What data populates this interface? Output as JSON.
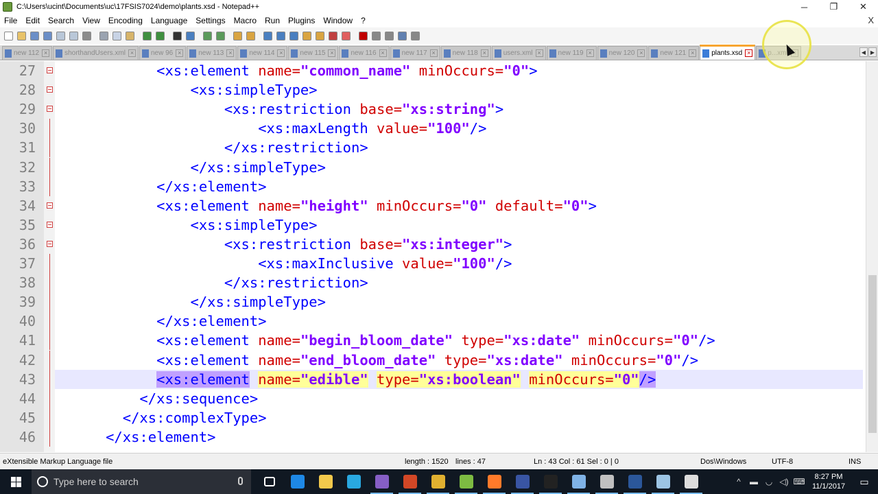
{
  "window": {
    "title": "C:\\Users\\ucint\\Documents\\uc\\17FSIS7024\\demo\\plants.xsd - Notepad++",
    "buttons": [
      "─",
      "❐",
      "✕"
    ]
  },
  "menu": {
    "items": [
      "File",
      "Edit",
      "Search",
      "View",
      "Encoding",
      "Language",
      "Settings",
      "Macro",
      "Run",
      "Plugins",
      "Window",
      "?"
    ],
    "close_doc": "X"
  },
  "toolbar": {
    "buttons": [
      {
        "name": "new-file-icon",
        "color": "#ffffff"
      },
      {
        "name": "open-file-icon",
        "color": "#e8c36a"
      },
      {
        "name": "save-icon",
        "color": "#6b8ec7"
      },
      {
        "name": "save-all-icon",
        "color": "#6b8ec7"
      },
      {
        "name": "close-icon",
        "color": "#b9c7d8"
      },
      {
        "name": "close-all-icon",
        "color": "#b9c7d8"
      },
      {
        "name": "print-icon",
        "color": "#8c8c8c"
      },
      {
        "name": "cut-icon",
        "color": "#9aa3b0"
      },
      {
        "name": "copy-icon",
        "color": "#c8d3e5"
      },
      {
        "name": "paste-icon",
        "color": "#d7b46a"
      },
      {
        "name": "undo-icon",
        "color": "#3f8f3f"
      },
      {
        "name": "redo-icon",
        "color": "#3f8f3f"
      },
      {
        "name": "find-icon",
        "color": "#333333"
      },
      {
        "name": "replace-icon",
        "color": "#4a7fc0"
      },
      {
        "name": "zoom-in-icon",
        "color": "#5a9a5a"
      },
      {
        "name": "zoom-out-icon",
        "color": "#5a9a5a"
      },
      {
        "name": "sync-vertical-icon",
        "color": "#d9a441"
      },
      {
        "name": "sync-horizontal-icon",
        "color": "#d9a441"
      },
      {
        "name": "word-wrap-icon",
        "color": "#4a7fc0"
      },
      {
        "name": "show-all-chars-icon",
        "color": "#4a7fc0"
      },
      {
        "name": "indent-guide-icon",
        "color": "#4a7fc0"
      },
      {
        "name": "udl-icon",
        "color": "#d9a441"
      },
      {
        "name": "doc-map-icon",
        "color": "#d9a441"
      },
      {
        "name": "function-list-icon",
        "color": "#c04040"
      },
      {
        "name": "folder-workspace-icon",
        "color": "#e06060"
      },
      {
        "name": "record-macro-icon",
        "color": "#c00000"
      },
      {
        "name": "stop-macro-icon",
        "color": "#888888"
      },
      {
        "name": "play-macro-icon",
        "color": "#888888"
      },
      {
        "name": "run-macro-multiple-icon",
        "color": "#6080b0"
      },
      {
        "name": "save-macro-icon",
        "color": "#888888"
      }
    ]
  },
  "tabs": [
    {
      "label": "new 112",
      "active": false
    },
    {
      "label": "shorthandUsers.xml",
      "active": false
    },
    {
      "label": "new 96",
      "active": false
    },
    {
      "label": "new 113",
      "active": false
    },
    {
      "label": "new 114",
      "active": false
    },
    {
      "label": "new 115",
      "active": false
    },
    {
      "label": "new 116",
      "active": false
    },
    {
      "label": "new 117",
      "active": false
    },
    {
      "label": "new 118",
      "active": false
    },
    {
      "label": "users.xml",
      "active": false
    },
    {
      "label": "new 119",
      "active": false
    },
    {
      "label": "new 120",
      "active": false
    },
    {
      "label": "new 121",
      "active": false
    },
    {
      "label": "plants.xsd",
      "active": true
    },
    {
      "label": "p...xml",
      "active": false
    }
  ],
  "tab_arrows": [
    "◀",
    "▶"
  ],
  "editor": {
    "current_line": 43,
    "lines": [
      {
        "num": "27",
        "indent": "            ",
        "fold": "box",
        "tokens": [
          [
            "tag",
            "<xs:element "
          ],
          [
            "attr",
            "name="
          ],
          [
            "val",
            "\"common_name\""
          ],
          [
            "attr",
            " minOccurs="
          ],
          [
            "val",
            "\"0\""
          ],
          [
            "tag",
            ">"
          ]
        ]
      },
      {
        "num": "28",
        "indent": "                ",
        "fold": "box",
        "tokens": [
          [
            "tag",
            "<xs:simpleType>"
          ]
        ]
      },
      {
        "num": "29",
        "indent": "                    ",
        "fold": "box",
        "tokens": [
          [
            "tag",
            "<xs:restriction "
          ],
          [
            "attr",
            "base="
          ],
          [
            "val",
            "\"xs:string\""
          ],
          [
            "tag",
            ">"
          ]
        ]
      },
      {
        "num": "30",
        "indent": "                        ",
        "fold": "line",
        "tokens": [
          [
            "tag",
            "<xs:maxLength "
          ],
          [
            "attr",
            "value="
          ],
          [
            "val",
            "\"100\""
          ],
          [
            "tag",
            "/>"
          ]
        ]
      },
      {
        "num": "31",
        "indent": "                    ",
        "fold": "line",
        "tokens": [
          [
            "tag",
            "</xs:restriction>"
          ]
        ]
      },
      {
        "num": "32",
        "indent": "                ",
        "fold": "line",
        "tokens": [
          [
            "tag",
            "</xs:simpleType>"
          ]
        ]
      },
      {
        "num": "33",
        "indent": "            ",
        "fold": "line",
        "tokens": [
          [
            "tag",
            "</xs:element>"
          ]
        ]
      },
      {
        "num": "34",
        "indent": "            ",
        "fold": "box",
        "tokens": [
          [
            "tag",
            "<xs:element "
          ],
          [
            "attr",
            "name="
          ],
          [
            "val",
            "\"height\""
          ],
          [
            "attr",
            " minOccurs="
          ],
          [
            "val",
            "\"0\""
          ],
          [
            "attr",
            " default="
          ],
          [
            "val",
            "\"0\""
          ],
          [
            "tag",
            ">"
          ]
        ]
      },
      {
        "num": "35",
        "indent": "                ",
        "fold": "box",
        "tokens": [
          [
            "tag",
            "<xs:simpleType>"
          ]
        ]
      },
      {
        "num": "36",
        "indent": "                    ",
        "fold": "box",
        "tokens": [
          [
            "tag",
            "<xs:restriction "
          ],
          [
            "attr",
            "base="
          ],
          [
            "val",
            "\"xs:integer\""
          ],
          [
            "tag",
            ">"
          ]
        ]
      },
      {
        "num": "37",
        "indent": "                        ",
        "fold": "line",
        "tokens": [
          [
            "tag",
            "<xs:maxInclusive "
          ],
          [
            "attr",
            "value="
          ],
          [
            "val",
            "\"100\""
          ],
          [
            "tag",
            "/>"
          ]
        ]
      },
      {
        "num": "38",
        "indent": "                    ",
        "fold": "line",
        "tokens": [
          [
            "tag",
            "</xs:restriction>"
          ]
        ]
      },
      {
        "num": "39",
        "indent": "                ",
        "fold": "line",
        "tokens": [
          [
            "tag",
            "</xs:simpleType>"
          ]
        ]
      },
      {
        "num": "40",
        "indent": "            ",
        "fold": "line",
        "tokens": [
          [
            "tag",
            "</xs:element>"
          ]
        ]
      },
      {
        "num": "41",
        "indent": "            ",
        "fold": "line",
        "tokens": [
          [
            "tag",
            "<xs:element "
          ],
          [
            "attr",
            "name="
          ],
          [
            "val",
            "\"begin_bloom_date\""
          ],
          [
            "attr",
            " type="
          ],
          [
            "val",
            "\"xs:date\""
          ],
          [
            "attr",
            " minOccurs="
          ],
          [
            "val",
            "\"0\""
          ],
          [
            "tag",
            "/>"
          ]
        ]
      },
      {
        "num": "42",
        "indent": "            ",
        "fold": "line",
        "tokens": [
          [
            "tag",
            "<xs:element "
          ],
          [
            "attr",
            "name="
          ],
          [
            "val",
            "\"end_bloom_date\""
          ],
          [
            "attr",
            " type="
          ],
          [
            "val",
            "\"xs:date\""
          ],
          [
            "attr",
            " minOccurs="
          ],
          [
            "val",
            "\"0\""
          ],
          [
            "tag",
            "/>"
          ]
        ]
      },
      {
        "num": "43",
        "indent": "            ",
        "fold": "line",
        "tokens": [
          [
            "sel-tag",
            "<xs:element"
          ],
          [
            "plain",
            " "
          ],
          [
            "sel-attr",
            "name="
          ],
          [
            "sel-val",
            "\"edible\""
          ],
          [
            "plain",
            " "
          ],
          [
            "sel-attr",
            "type="
          ],
          [
            "sel-val",
            "\"xs:boolean\""
          ],
          [
            "plain",
            " "
          ],
          [
            "sel-attr",
            "minOccurs="
          ],
          [
            "sel-val",
            "\"0\""
          ],
          [
            "sel-tag",
            "/>"
          ]
        ]
      },
      {
        "num": "44",
        "indent": "          ",
        "fold": "line",
        "tokens": [
          [
            "tag",
            "</xs:sequence>"
          ]
        ]
      },
      {
        "num": "45",
        "indent": "        ",
        "fold": "line",
        "tokens": [
          [
            "tag",
            "</xs:complexType>"
          ]
        ]
      },
      {
        "num": "46",
        "indent": "      ",
        "fold": "line",
        "tokens": [
          [
            "tag",
            "</xs:element>"
          ]
        ]
      }
    ]
  },
  "status": {
    "file_type": "eXtensible Markup Language file",
    "length": "length : 1520",
    "lines": "lines : 47",
    "position": "Ln : 43    Col : 61    Sel : 0 | 0",
    "eol": "Dos\\Windows",
    "encoding": "UTF-8",
    "mode": "INS"
  },
  "taskbar": {
    "search_placeholder": "Type here to search",
    "apps": [
      {
        "name": "task-view-icon",
        "color": "#ffffff",
        "running": false
      },
      {
        "name": "edge-icon",
        "color": "#1e88e5",
        "running": false
      },
      {
        "name": "file-explorer-icon",
        "color": "#f2c94c",
        "running": false
      },
      {
        "name": "skype-icon",
        "color": "#29a8e0",
        "running": false
      },
      {
        "name": "visual-studio-icon",
        "color": "#865fc5",
        "running": true
      },
      {
        "name": "powerpoint-icon",
        "color": "#d24726",
        "running": true
      },
      {
        "name": "chrome-icon",
        "color": "#e0b030",
        "running": true
      },
      {
        "name": "notepadpp-icon",
        "color": "#7dbb42",
        "running": true
      },
      {
        "name": "firefox-icon",
        "color": "#ff7a2a",
        "running": true
      },
      {
        "name": "visio-icon",
        "color": "#3955a3",
        "running": true
      },
      {
        "name": "cmd-icon",
        "color": "#222222",
        "running": true
      },
      {
        "name": "paint-icon",
        "color": "#7fb2e5",
        "running": true
      },
      {
        "name": "tool-icon",
        "color": "#c0c0c0",
        "running": true
      },
      {
        "name": "word-icon",
        "color": "#2b579a",
        "running": true
      },
      {
        "name": "notepad-icon",
        "color": "#9cc4e4",
        "running": true
      },
      {
        "name": "obs-icon",
        "color": "#dddddd",
        "running": true
      }
    ],
    "tray_icons": [
      "^",
      "▬",
      "◡",
      "◁)",
      "⌨"
    ],
    "time": "8:27 PM",
    "date": "11/1/2017",
    "notification": "▭"
  }
}
